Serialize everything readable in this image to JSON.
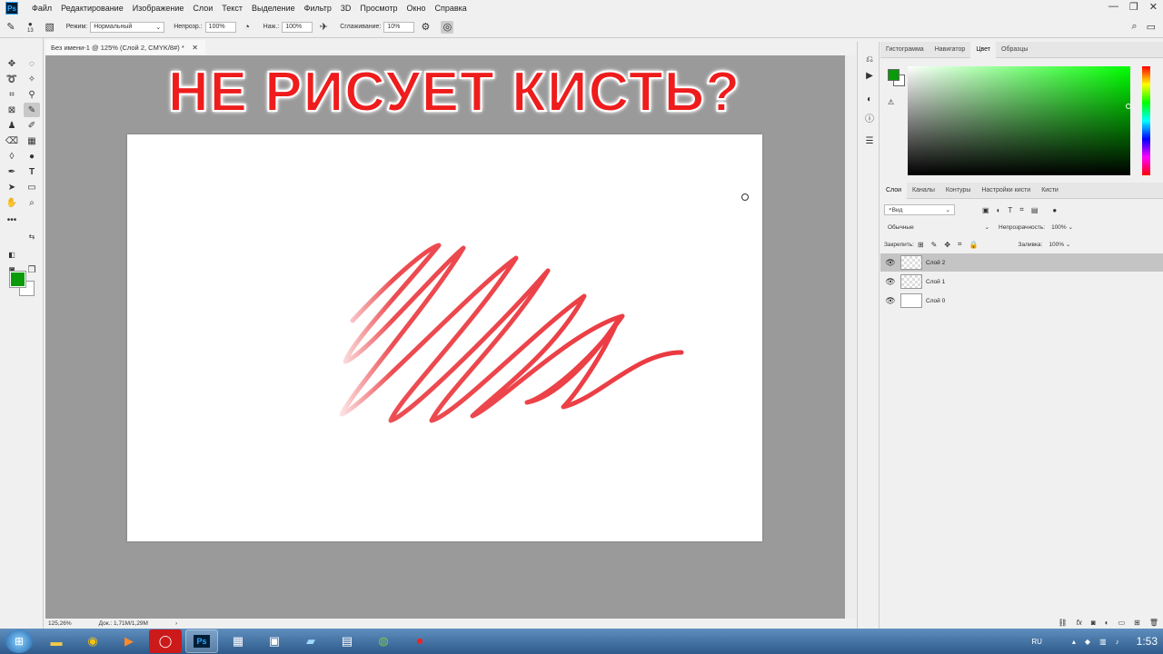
{
  "menu": [
    "Файл",
    "Редактирование",
    "Изображение",
    "Слои",
    "Текст",
    "Выделение",
    "Фильтр",
    "3D",
    "Просмотр",
    "Окно",
    "Справка"
  ],
  "options": {
    "brush_size": "13",
    "mode_label": "Режим:",
    "mode_value": "Нормальный",
    "opacity_label": "Непрозр.:",
    "opacity_value": "100%",
    "flow_label": "Наж.:",
    "flow_value": "100%",
    "smoothing_label": "Сглаживание:",
    "smoothing_value": "10%"
  },
  "document": {
    "tab_title": "Без имени-1 @ 125% (Слой 2, CMYK/8#) *",
    "headline": "НЕ РИСУЕТ КИСТЬ?",
    "zoom": "125,26%",
    "doc_info": "Док.: 1,71M/1,29M"
  },
  "colors": {
    "foreground": "#0a9a0a",
    "stroke": "#e8232a",
    "headline": "#ee1c1c"
  },
  "color_panel": {
    "tabs": [
      "Гистограмма",
      "Навигатор",
      "Цвет",
      "Образцы"
    ],
    "active_tab": "Цвет"
  },
  "layers_panel": {
    "tabs": [
      "Слои",
      "Каналы",
      "Контуры",
      "Настройки кисти",
      "Кисти"
    ],
    "filter_label": "Вид",
    "blend_mode": "Обычные",
    "opacity_label": "Непрозрачность:",
    "opacity_value": "100%",
    "lock_label": "Закрепить:",
    "fill_label": "Заливка:",
    "fill_value": "100%",
    "layers": [
      {
        "name": "Слой 2",
        "selected": true
      },
      {
        "name": "Слой 1",
        "selected": false
      },
      {
        "name": "Слой 0",
        "selected": false
      }
    ]
  },
  "taskbar": {
    "language": "RU",
    "time": "1:53"
  }
}
